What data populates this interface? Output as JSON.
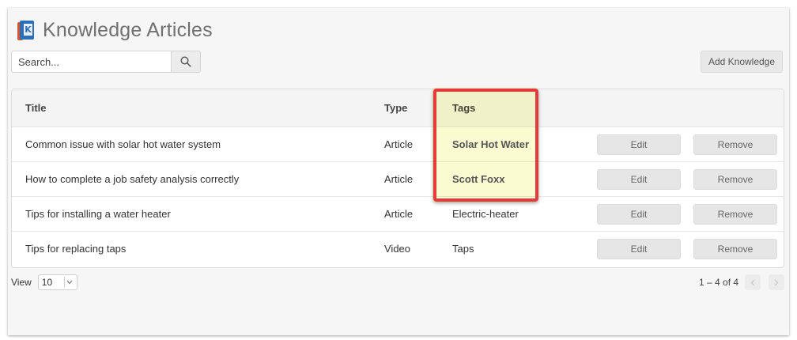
{
  "header": {
    "title": "Knowledge Articles",
    "icon": "book-icon"
  },
  "search": {
    "placeholder": "Search...",
    "value": ""
  },
  "toolbar": {
    "add_label": "Add Knowledge"
  },
  "table": {
    "columns": [
      "Title",
      "Type",
      "Tags"
    ],
    "rows": [
      {
        "title": "Common issue with solar hot water system",
        "type": "Article",
        "tags": "Solar Hot Water",
        "edit": "Edit",
        "remove": "Remove"
      },
      {
        "title": "How to complete a job safety analysis correctly",
        "type": "Article",
        "tags": "Scott Foxx",
        "edit": "Edit",
        "remove": "Remove"
      },
      {
        "title": "Tips for installing a water heater",
        "type": "Article",
        "tags": "Electric-heater",
        "edit": "Edit",
        "remove": "Remove"
      },
      {
        "title": "Tips for replacing taps",
        "type": "Video",
        "tags": "Taps",
        "edit": "Edit",
        "remove": "Remove"
      }
    ]
  },
  "footer": {
    "view_label": "View",
    "view_value": "10",
    "range_text": "1 – 4 of 4"
  },
  "colors": {
    "highlight_border": "#e53a3c",
    "highlight_fill": "#fbfbcd",
    "title_gray": "#707070"
  }
}
